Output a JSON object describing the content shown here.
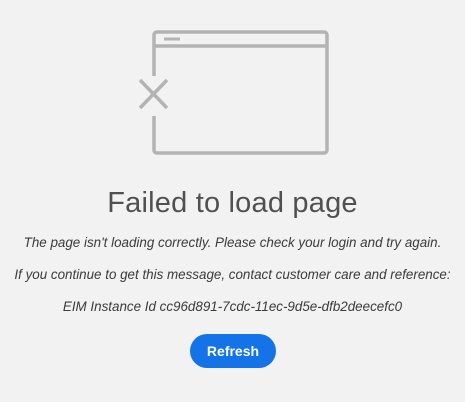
{
  "error": {
    "title": "Failed to load page",
    "message_1": "The page isn't loading correctly. Please check your login and try again.",
    "message_2": "If you continue to get this message, contact customer care and reference:",
    "instance_id": "EIM Instance Id cc96d891-7cdc-11ec-9d5e-dfb2deecefc0"
  },
  "actions": {
    "refresh_label": "Refresh"
  },
  "icons": {
    "illustration": "broken-window-icon"
  },
  "colors": {
    "background": "#f2f2f2",
    "accent": "#1473e6",
    "illustration_stroke": "#b3b3b3",
    "title_text": "#505050"
  }
}
